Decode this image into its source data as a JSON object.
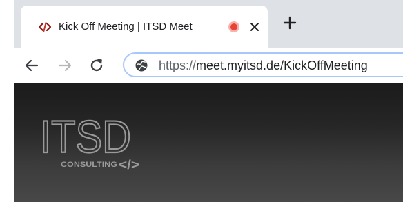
{
  "tab": {
    "title": "Kick Off Meeting | ITSD Meet",
    "favicon": "code-brackets-icon",
    "recording_indicator": "recording-dot-icon",
    "close": "close-icon"
  },
  "new_tab": "plus-icon",
  "toolbar": {
    "back": "back-arrow-icon",
    "forward": "forward-arrow-icon",
    "reload": "reload-icon",
    "site_info": "site-info-icon",
    "url_scheme": "https://",
    "url_rest": "meet.myitsd.de/KickOffMeeting"
  },
  "logo": {
    "wordmark": "ITSD",
    "tagline": "CONSULTING",
    "symbol": "</>"
  },
  "colors": {
    "tabstrip": "#dee1e6",
    "favicon": "#8b1a1a",
    "recording": "#ea4335",
    "page_top": "#1b1b1b",
    "page_bottom": "#484848",
    "logo": "#9a9a9a"
  }
}
